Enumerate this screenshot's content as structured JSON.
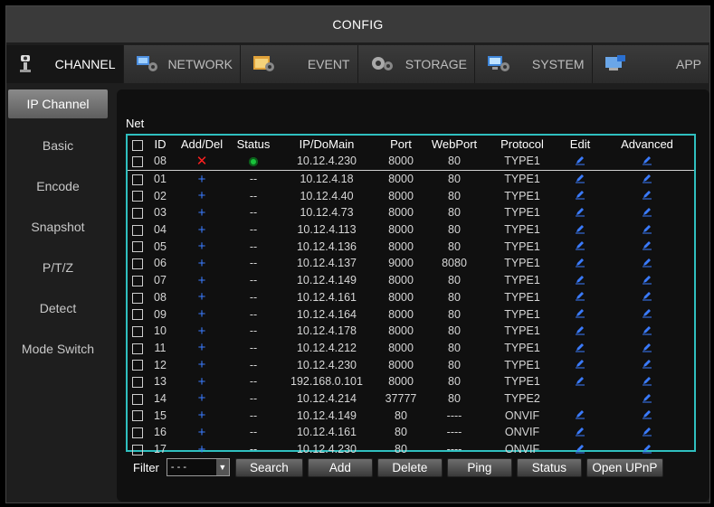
{
  "title": "CONFIG",
  "tabs": [
    {
      "label": "CHANNEL",
      "icon": "camera-icon"
    },
    {
      "label": "NETWORK",
      "icon": "network-icon"
    },
    {
      "label": "EVENT",
      "icon": "event-icon"
    },
    {
      "label": "STORAGE",
      "icon": "storage-icon"
    },
    {
      "label": "SYSTEM",
      "icon": "system-icon"
    },
    {
      "label": "APP",
      "icon": "app-icon"
    }
  ],
  "sidebar": {
    "items": [
      "IP Channel",
      "Basic",
      "Encode",
      "Snapshot",
      "P/T/Z",
      "Detect",
      "Mode Switch"
    ]
  },
  "section_label": "Net",
  "table": {
    "headers": [
      "ID",
      "Add/Del",
      "Status",
      "IP/DoMain",
      "Port",
      "WebPort",
      "Protocol",
      "Edit",
      "Advanced"
    ],
    "rows": [
      {
        "id": "08",
        "action": "del",
        "status": "online",
        "ip": "10.12.4.230",
        "port": "8000",
        "webport": "80",
        "protocol": "TYPE1",
        "edit": true
      },
      {
        "id": "01",
        "action": "add",
        "status": "--",
        "ip": "10.12.4.18",
        "port": "8000",
        "webport": "80",
        "protocol": "TYPE1",
        "edit": true
      },
      {
        "id": "02",
        "action": "add",
        "status": "--",
        "ip": "10.12.4.40",
        "port": "8000",
        "webport": "80",
        "protocol": "TYPE1",
        "edit": true
      },
      {
        "id": "03",
        "action": "add",
        "status": "--",
        "ip": "10.12.4.73",
        "port": "8000",
        "webport": "80",
        "protocol": "TYPE1",
        "edit": true
      },
      {
        "id": "04",
        "action": "add",
        "status": "--",
        "ip": "10.12.4.113",
        "port": "8000",
        "webport": "80",
        "protocol": "TYPE1",
        "edit": true
      },
      {
        "id": "05",
        "action": "add",
        "status": "--",
        "ip": "10.12.4.136",
        "port": "8000",
        "webport": "80",
        "protocol": "TYPE1",
        "edit": true
      },
      {
        "id": "06",
        "action": "add",
        "status": "--",
        "ip": "10.12.4.137",
        "port": "9000",
        "webport": "8080",
        "protocol": "TYPE1",
        "edit": true
      },
      {
        "id": "07",
        "action": "add",
        "status": "--",
        "ip": "10.12.4.149",
        "port": "8000",
        "webport": "80",
        "protocol": "TYPE1",
        "edit": true
      },
      {
        "id": "08",
        "action": "add",
        "status": "--",
        "ip": "10.12.4.161",
        "port": "8000",
        "webport": "80",
        "protocol": "TYPE1",
        "edit": true
      },
      {
        "id": "09",
        "action": "add",
        "status": "--",
        "ip": "10.12.4.164",
        "port": "8000",
        "webport": "80",
        "protocol": "TYPE1",
        "edit": true
      },
      {
        "id": "10",
        "action": "add",
        "status": "--",
        "ip": "10.12.4.178",
        "port": "8000",
        "webport": "80",
        "protocol": "TYPE1",
        "edit": true
      },
      {
        "id": "11",
        "action": "add",
        "status": "--",
        "ip": "10.12.4.212",
        "port": "8000",
        "webport": "80",
        "protocol": "TYPE1",
        "edit": true
      },
      {
        "id": "12",
        "action": "add",
        "status": "--",
        "ip": "10.12.4.230",
        "port": "8000",
        "webport": "80",
        "protocol": "TYPE1",
        "edit": true
      },
      {
        "id": "13",
        "action": "add",
        "status": "--",
        "ip": "192.168.0.101",
        "port": "8000",
        "webport": "80",
        "protocol": "TYPE1",
        "edit": true
      },
      {
        "id": "14",
        "action": "add",
        "status": "--",
        "ip": "10.12.4.214",
        "port": "37777",
        "webport": "80",
        "protocol": "TYPE2",
        "edit": false
      },
      {
        "id": "15",
        "action": "add",
        "status": "--",
        "ip": "10.12.4.149",
        "port": "80",
        "webport": "----",
        "protocol": "ONVIF",
        "edit": true
      },
      {
        "id": "16",
        "action": "add",
        "status": "--",
        "ip": "10.12.4.161",
        "port": "80",
        "webport": "----",
        "protocol": "ONVIF",
        "edit": true
      },
      {
        "id": "17",
        "action": "add",
        "status": "--",
        "ip": "10.12.4.230",
        "port": "80",
        "webport": "----",
        "protocol": "ONVIF",
        "edit": true
      }
    ]
  },
  "filter": {
    "label": "Filter",
    "value": "- - -"
  },
  "buttons": [
    "Search",
    "Add",
    "Delete",
    "Ping",
    "Status",
    "Open UPnP"
  ],
  "colors": {
    "accent": "#2fbfbf",
    "add": "#3a7bff",
    "delete": "#ff2020",
    "online": "#19c23b"
  }
}
